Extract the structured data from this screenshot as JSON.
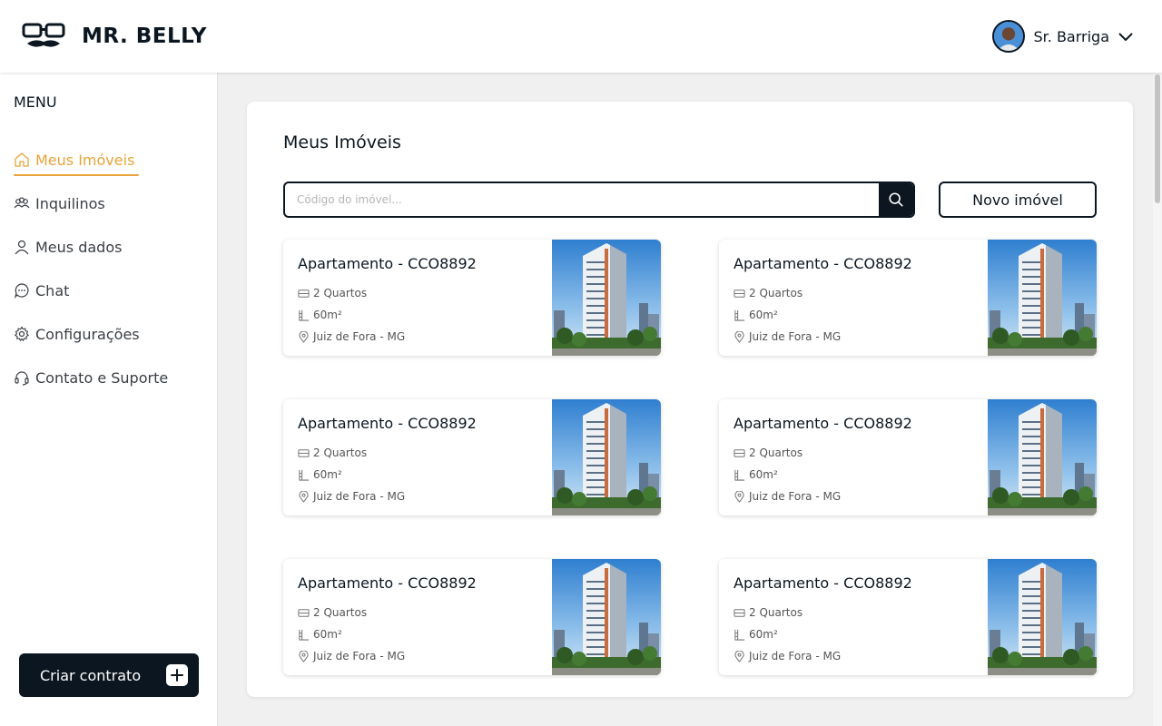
{
  "app": {
    "brand": "MR. BELLY"
  },
  "user": {
    "name": "Sr. Barriga"
  },
  "sidebar": {
    "menu_title": "MENU",
    "items": [
      {
        "label": "Meus Imóveis",
        "icon": "home-icon",
        "active": true
      },
      {
        "label": "Inquilinos",
        "icon": "users-icon"
      },
      {
        "label": "Meus dados",
        "icon": "user-icon"
      },
      {
        "label": "Chat",
        "icon": "chat-icon"
      },
      {
        "label": "Configurações",
        "icon": "gear-icon"
      },
      {
        "label": "Contato e Suporte",
        "icon": "headset-icon"
      }
    ],
    "cta_label": "Criar contrato"
  },
  "main": {
    "title": "Meus Imóveis",
    "search_placeholder": "Código do imóvel...",
    "new_button": "Novo imóvel",
    "cards": [
      {
        "title": "Apartamento - CCO8892",
        "rooms": "2 Quartos",
        "area": "60m²",
        "location": "Juiz de Fora - MG"
      },
      {
        "title": "Apartamento - CCO8892",
        "rooms": "2 Quartos",
        "area": "60m²",
        "location": "Juiz de Fora - MG"
      },
      {
        "title": "Apartamento - CCO8892",
        "rooms": "2 Quartos",
        "area": "60m²",
        "location": "Juiz de Fora - MG"
      },
      {
        "title": "Apartamento - CCO8892",
        "rooms": "2 Quartos",
        "area": "60m²",
        "location": "Juiz de Fora - MG"
      },
      {
        "title": "Apartamento - CCO8892",
        "rooms": "2 Quartos",
        "area": "60m²",
        "location": "Juiz de Fora - MG"
      },
      {
        "title": "Apartamento - CCO8892",
        "rooms": "2 Quartos",
        "area": "60m²",
        "location": "Juiz de Fora - MG"
      }
    ]
  },
  "colors": {
    "primary": "#0b1620",
    "accent": "#e8a33a",
    "background": "#f0f0f0"
  }
}
